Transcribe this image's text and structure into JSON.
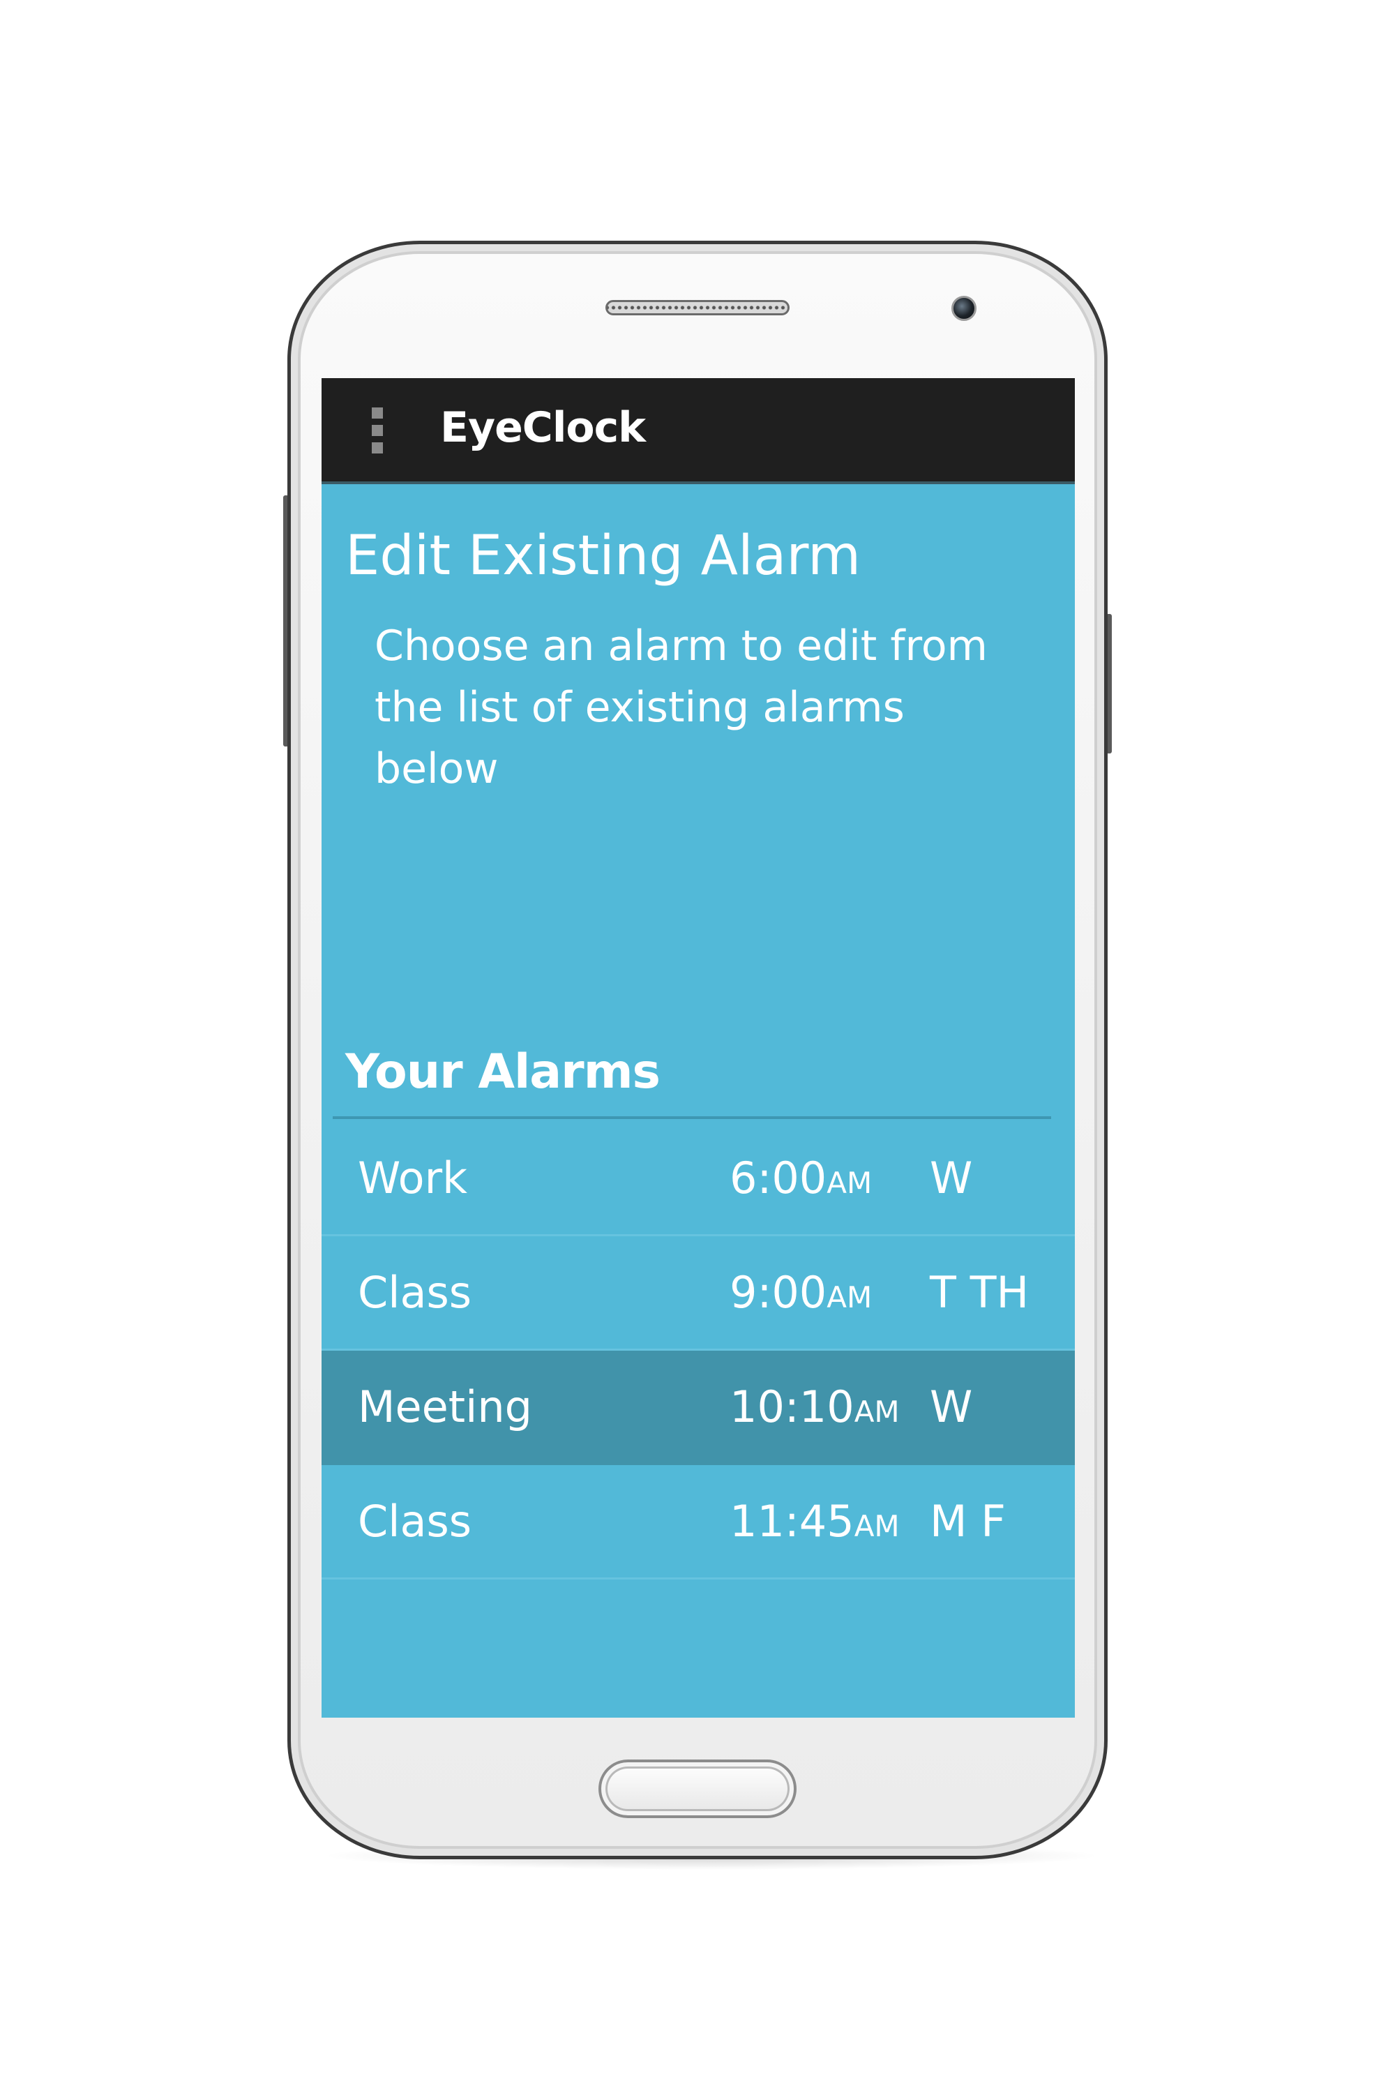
{
  "app": {
    "title": "EyeClock"
  },
  "page": {
    "title": "Edit Existing Alarm",
    "subtitle": "Choose an alarm to edit from the list of existing alarms below"
  },
  "alarms_section": {
    "heading": "Your Alarms",
    "items": [
      {
        "name": "Work",
        "time": "6:00",
        "ampm": "AM",
        "days": "W",
        "selected": false
      },
      {
        "name": "Class",
        "time": "9:00",
        "ampm": "AM",
        "days": "T TH",
        "selected": false
      },
      {
        "name": "Meeting",
        "time": "10:10",
        "ampm": "AM",
        "days": "W",
        "selected": true
      },
      {
        "name": "Class",
        "time": "11:45",
        "ampm": "AM",
        "days": "M F",
        "selected": false
      }
    ]
  },
  "icons": {
    "menu": "overflow-menu-icon"
  },
  "colors": {
    "screen_background": "#52b9d8",
    "action_bar": "#1f1f1f",
    "selected_row": "#4193aa",
    "text": "#ffffff"
  }
}
